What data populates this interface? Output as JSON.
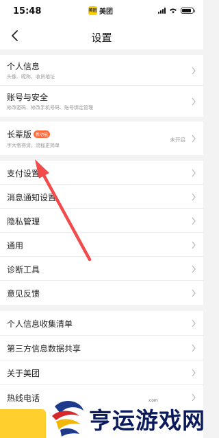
{
  "status_bar": {
    "time": "15:48",
    "brand_logo": "美团",
    "brand_text": "美团"
  },
  "nav": {
    "title": "设置",
    "back_icon": "chevron-left-icon"
  },
  "sections": [
    [
      {
        "title": "个人信息",
        "subtitle": "头像、昵称、收货地址"
      },
      {
        "title": "账号与安全",
        "subtitle": "修改密码、修改手机号码、账号绑定管理"
      }
    ],
    [
      {
        "title": "长辈版",
        "badge": "新功能",
        "subtitle": "字大看得清，流程更简单",
        "right": "未开启"
      }
    ],
    [
      {
        "title": "支付设置"
      },
      {
        "title": "消息通知设置"
      },
      {
        "title": "隐私管理"
      },
      {
        "title": "通用"
      },
      {
        "title": "诊断工具"
      },
      {
        "title": "意见反馈"
      }
    ],
    [
      {
        "title": "个人信息收集清单"
      },
      {
        "title": "第三方信息数据共享"
      },
      {
        "title": "关于美团"
      },
      {
        "title": "热线电话"
      }
    ]
  ],
  "watermark": {
    "text": "亨运游戏网",
    "dotcom": ".com"
  },
  "colors": {
    "accent": "#ffcf2e",
    "arrow": "#f24b4b",
    "badge": "#ff6a3d",
    "watermark": "#0b1a5a"
  }
}
